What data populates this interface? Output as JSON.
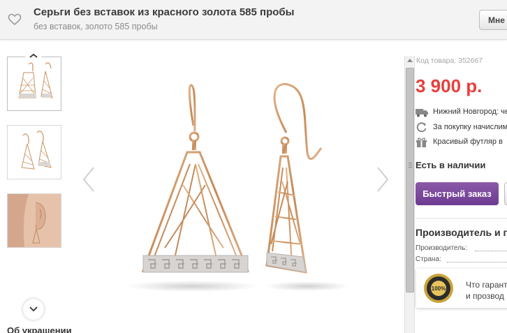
{
  "header": {
    "title": "Серьги без вставок из красного золота 585 пробы",
    "subtitle": "без вставок, золото 585 пробы",
    "button_label": "Мне"
  },
  "gallery": {
    "thumbnail_count": 3,
    "section_title": "Об украшении"
  },
  "product": {
    "code": "Код товара: 352667",
    "price": "3 900 р.",
    "info": [
      {
        "icon": "truck-icon",
        "text": "Нижний Новгород: че"
      },
      {
        "icon": "refresh-icon",
        "text": "За покупку начислим"
      },
      {
        "icon": "gift-icon",
        "text": "Красивый футляр в"
      }
    ],
    "stock": "Есть в наличии",
    "buy_button": "Быстрый заказ"
  },
  "manufacturer": {
    "heading": "Производитель и п",
    "labels": [
      "Производитель:",
      "Страна:"
    ]
  },
  "guarantee": {
    "badge_text": "100%",
    "line1": "Что гарант",
    "line2": "и прозвод"
  },
  "colors": {
    "price": "#e8403e",
    "buy_button": "#6d3b91",
    "gold": "#c9925f",
    "silver": "#d4d2d0"
  }
}
